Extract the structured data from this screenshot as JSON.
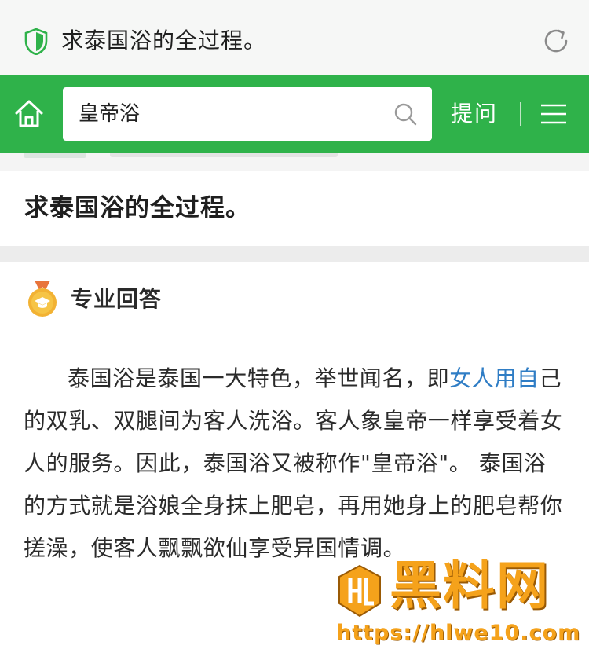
{
  "browser": {
    "page_title": "求泰国浴的全过程。",
    "icons": {
      "security": "shield-icon",
      "reload": "refresh-icon"
    }
  },
  "header": {
    "home_icon": "home-icon",
    "search": {
      "value": "皇帝浴",
      "icon": "search-icon"
    },
    "ask_label": "提问",
    "menu_icon": "menu-icon"
  },
  "question": {
    "title": "求泰国浴的全过程。"
  },
  "answer": {
    "badge_icon": "medal-icon",
    "label": "专业回答",
    "body": {
      "part1": "泰国浴是泰国一大特色，举世闻名，即",
      "highlight": "女人用自",
      "part2": "己的双乳、双腿间为客人洗浴。客人象皇帝一样享受着女人的服务。因此，泰国浴又被称作\"皇帝浴\"。 泰国浴的方式就是浴娘全身抹上肥皂，再用她身上的肥皂帮你搓澡，使客人飘飘欲仙享受异国情调。"
    }
  },
  "watermark": {
    "brand": "黑料网",
    "url": "https://hlwe10.com"
  },
  "colors": {
    "green": "#2fb24a",
    "link_blue": "#2f7dc5",
    "watermark_orange": "#f5a21b",
    "medal_gold": "#f2b233"
  }
}
